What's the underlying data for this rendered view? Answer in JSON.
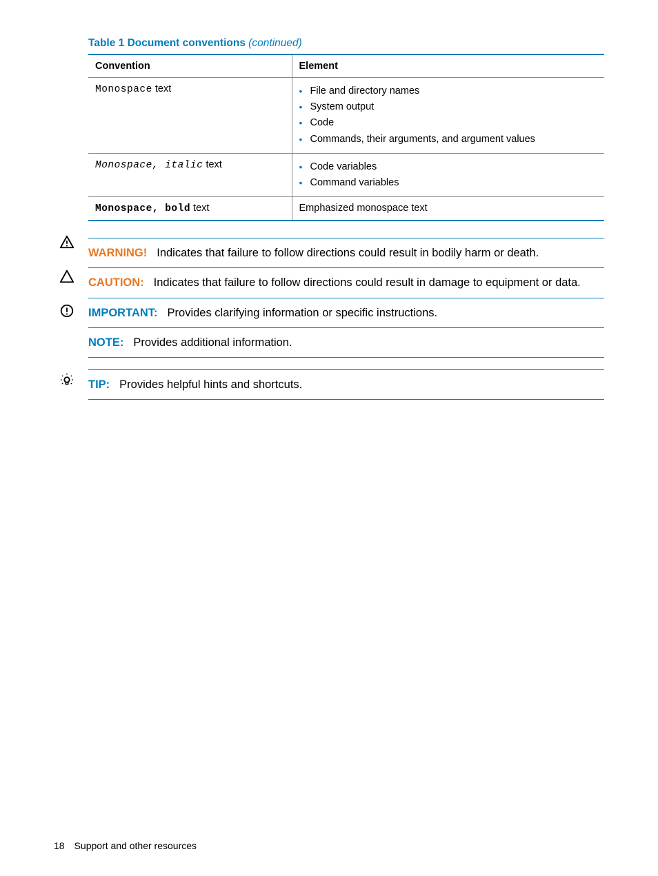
{
  "table": {
    "title_strong": "Table 1 Document conventions",
    "title_continued": "(continued)",
    "headers": {
      "col1": "Convention",
      "col2": "Element"
    },
    "rows": [
      {
        "conv_mono": "Monospace",
        "conv_post": " text",
        "items": [
          "File and directory names",
          "System output",
          "Code",
          "Commands, their arguments, and argument values"
        ]
      },
      {
        "conv_mono_italic": "Monospace, italic",
        "conv_post": " text",
        "items": [
          "Code variables",
          "Command variables"
        ]
      },
      {
        "conv_mono_bold": "Monospace, bold",
        "conv_post": " text",
        "element_text": "Emphasized monospace text"
      }
    ]
  },
  "admon": {
    "warning": {
      "label": "WARNING!",
      "text": "Indicates that failure to follow directions could result in bodily harm or death."
    },
    "caution": {
      "label": "CAUTION:",
      "text": "Indicates that failure to follow directions could result in damage to equipment or data."
    },
    "important": {
      "label": "IMPORTANT:",
      "text": "Provides clarifying information or specific instructions."
    },
    "note": {
      "label": "NOTE:",
      "text": "Provides additional information."
    },
    "tip": {
      "label": "TIP:",
      "text": "Provides helpful hints and shortcuts."
    }
  },
  "footer": {
    "page": "18",
    "section": "Support and other resources"
  }
}
